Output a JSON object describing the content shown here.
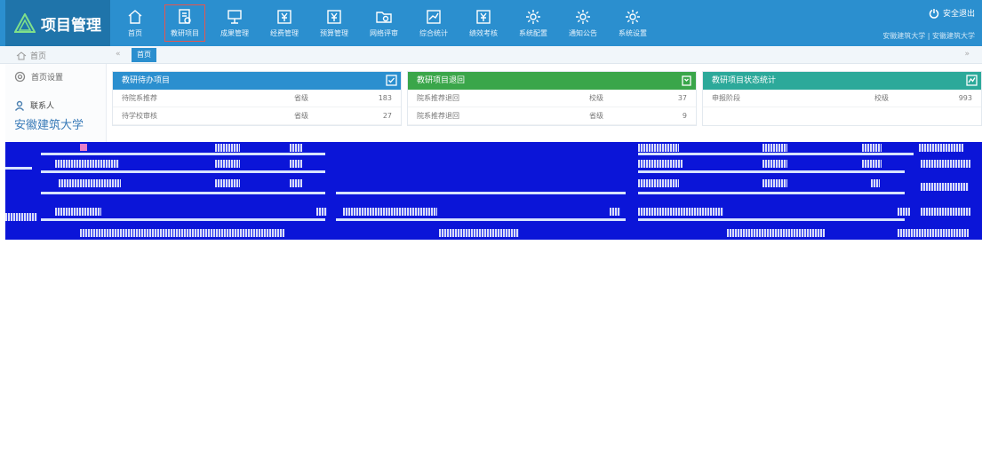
{
  "app": {
    "title": "项目管理"
  },
  "nav": {
    "items": [
      {
        "label": "首页",
        "icon": "home-icon"
      },
      {
        "label": "教研项目",
        "icon": "project-icon"
      },
      {
        "label": "成果管理",
        "icon": "board-icon"
      },
      {
        "label": "经费管理",
        "icon": "yuan-icon"
      },
      {
        "label": "预算管理",
        "icon": "yuan-icon"
      },
      {
        "label": "网络评审",
        "icon": "folder-icon"
      },
      {
        "label": "综合统计",
        "icon": "chart-icon"
      },
      {
        "label": "绩效考核",
        "icon": "yuan-icon"
      },
      {
        "label": "系统配置",
        "icon": "gear-icon"
      },
      {
        "label": "通知公告",
        "icon": "gear-icon"
      },
      {
        "label": "系统设置",
        "icon": "gear-icon"
      }
    ],
    "active_index": 1
  },
  "header_right": {
    "logout": "安全退出",
    "user": "安徽建筑大学 | 安徽建筑大学"
  },
  "crumb": {
    "home": "首页",
    "tab": "首页"
  },
  "sidebar": {
    "settings": "首页设置",
    "contact_label": "联系人",
    "school": "安徽建筑大学"
  },
  "panels": {
    "todo": {
      "title": "教研待办项目",
      "rows": [
        {
          "name": "待院系推荐",
          "level": "省级",
          "count": "183"
        },
        {
          "name": "待学校审核",
          "level": "省级",
          "count": "27"
        }
      ]
    },
    "returned": {
      "title": "教研项目退回",
      "rows": [
        {
          "name": "院系推荐退回",
          "level": "校级",
          "count": "37"
        },
        {
          "name": "院系推荐退回",
          "level": "省级",
          "count": "9"
        }
      ]
    },
    "stats": {
      "title": "教研项目状态统计",
      "rows": [
        {
          "name": "申报阶段",
          "level": "校级",
          "count": "993"
        }
      ]
    }
  },
  "colors": {
    "header": "#2b8fcf",
    "logo_bg": "#1f74aa",
    "todo_head": "#2b8fcf",
    "returned_head": "#3aa64a",
    "stats_head": "#2ca99a",
    "corruption": "#0b15d8"
  }
}
